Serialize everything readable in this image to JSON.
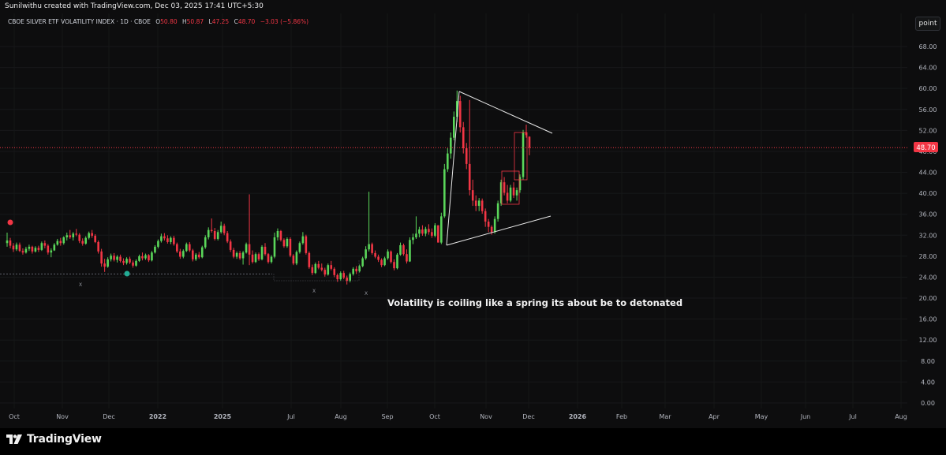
{
  "header": {
    "attribution": "Sunilwithu created with TradingView.com, Dec 03, 2025 17:41 UTC+5:30"
  },
  "legend": {
    "symbol": "CBOE SILVER ETF VOLATILITY INDEX · 1D · CBOE",
    "o_label": "O",
    "o_value": "50.80",
    "h_label": "H",
    "h_value": "50.87",
    "l_label": "L",
    "l_value": "47.25",
    "c_label": "C",
    "c_value": "48.70",
    "change": "−3.03 (−5.86%)"
  },
  "toolbar": {
    "point_label": "point"
  },
  "annotation": {
    "text": "Volatility is coiling like a spring its about be to detonated"
  },
  "price_badge": {
    "value": "48.70",
    "color": "#f23645"
  },
  "markers": {
    "x_label": "X"
  },
  "brand": {
    "name": "TradingView"
  },
  "colors": {
    "up": "#22ab94",
    "down": "#f23645",
    "up_bright": "#5ad65a",
    "background": "#0d0d0e"
  },
  "chart_data": {
    "type": "candlestick",
    "title": "CBOE SILVER ETF VOLATILITY INDEX",
    "interval": "1D",
    "ylim": [
      0,
      72
    ],
    "y_ticks": [
      "68.00",
      "64.00",
      "60.00",
      "56.00",
      "52.00",
      "48.00",
      "44.00",
      "40.00",
      "36.00",
      "32.00",
      "28.00",
      "24.00",
      "20.00",
      "16.00",
      "12.00",
      "8.00",
      "4.00",
      "0.00"
    ],
    "x_ticks": [
      "Oct",
      "Nov",
      "Dec",
      "2022",
      "2025",
      "Jul",
      "Aug",
      "Sep",
      "Oct",
      "Nov",
      "Dec",
      "2026",
      "Feb",
      "Mar",
      "Apr",
      "May",
      "Jun",
      "Jul",
      "Aug"
    ],
    "last_price": 48.7,
    "candles": [
      {
        "o": 30.5,
        "h": 32.5,
        "l": 29.8,
        "c": 31.0
      },
      {
        "o": 31.0,
        "h": 31.5,
        "l": 29.5,
        "c": 30.0
      },
      {
        "o": 30.0,
        "h": 30.5,
        "l": 28.8,
        "c": 29.3
      },
      {
        "o": 29.3,
        "h": 30.6,
        "l": 29.0,
        "c": 30.2
      },
      {
        "o": 30.2,
        "h": 30.6,
        "l": 28.8,
        "c": 29.0
      },
      {
        "o": 29.0,
        "h": 29.5,
        "l": 28.3,
        "c": 28.7
      },
      {
        "o": 28.7,
        "h": 29.8,
        "l": 28.5,
        "c": 29.4
      },
      {
        "o": 29.4,
        "h": 30.2,
        "l": 29.0,
        "c": 29.8
      },
      {
        "o": 29.8,
        "h": 30.0,
        "l": 28.5,
        "c": 28.9
      },
      {
        "o": 28.9,
        "h": 29.9,
        "l": 28.7,
        "c": 29.6
      },
      {
        "o": 29.6,
        "h": 30.0,
        "l": 28.8,
        "c": 29.2
      },
      {
        "o": 29.2,
        "h": 30.8,
        "l": 29.0,
        "c": 30.5
      },
      {
        "o": 30.5,
        "h": 31.0,
        "l": 29.5,
        "c": 30.0
      },
      {
        "o": 30.0,
        "h": 30.3,
        "l": 28.3,
        "c": 28.7
      },
      {
        "o": 28.7,
        "h": 29.5,
        "l": 27.8,
        "c": 29.1
      },
      {
        "o": 29.1,
        "h": 30.5,
        "l": 29.0,
        "c": 30.2
      },
      {
        "o": 30.2,
        "h": 31.3,
        "l": 30.0,
        "c": 30.9
      },
      {
        "o": 30.9,
        "h": 31.5,
        "l": 30.0,
        "c": 30.5
      },
      {
        "o": 30.5,
        "h": 31.8,
        "l": 30.2,
        "c": 31.6
      },
      {
        "o": 31.6,
        "h": 32.5,
        "l": 31.0,
        "c": 32.0
      },
      {
        "o": 32.0,
        "h": 33.0,
        "l": 31.3,
        "c": 31.6
      },
      {
        "o": 31.6,
        "h": 32.6,
        "l": 31.0,
        "c": 32.3
      },
      {
        "o": 32.3,
        "h": 33.2,
        "l": 31.8,
        "c": 32.1
      },
      {
        "o": 32.1,
        "h": 32.4,
        "l": 30.5,
        "c": 30.9
      },
      {
        "o": 30.9,
        "h": 31.4,
        "l": 30.0,
        "c": 30.4
      },
      {
        "o": 30.4,
        "h": 31.8,
        "l": 30.2,
        "c": 31.5
      },
      {
        "o": 31.5,
        "h": 32.7,
        "l": 31.2,
        "c": 32.4
      },
      {
        "o": 32.4,
        "h": 33.0,
        "l": 31.5,
        "c": 31.9
      },
      {
        "o": 31.9,
        "h": 32.2,
        "l": 30.5,
        "c": 30.7
      },
      {
        "o": 30.7,
        "h": 31.0,
        "l": 28.5,
        "c": 28.9
      },
      {
        "o": 28.9,
        "h": 29.4,
        "l": 26.0,
        "c": 26.6
      },
      {
        "o": 26.6,
        "h": 27.5,
        "l": 25.0,
        "c": 26.0
      },
      {
        "o": 26.0,
        "h": 27.8,
        "l": 25.8,
        "c": 27.4
      },
      {
        "o": 27.4,
        "h": 28.5,
        "l": 27.0,
        "c": 28.1
      },
      {
        "o": 28.1,
        "h": 28.6,
        "l": 27.0,
        "c": 27.3
      },
      {
        "o": 27.3,
        "h": 28.2,
        "l": 26.8,
        "c": 27.9
      },
      {
        "o": 27.9,
        "h": 28.3,
        "l": 26.8,
        "c": 27.1
      },
      {
        "o": 27.1,
        "h": 27.6,
        "l": 26.3,
        "c": 26.7
      },
      {
        "o": 26.7,
        "h": 27.8,
        "l": 26.4,
        "c": 27.5
      },
      {
        "o": 27.5,
        "h": 27.9,
        "l": 26.5,
        "c": 26.8
      },
      {
        "o": 26.8,
        "h": 27.2,
        "l": 25.8,
        "c": 26.2
      },
      {
        "o": 26.2,
        "h": 27.4,
        "l": 26.0,
        "c": 27.1
      },
      {
        "o": 27.1,
        "h": 28.3,
        "l": 26.9,
        "c": 28.0
      },
      {
        "o": 28.0,
        "h": 28.7,
        "l": 27.2,
        "c": 27.6
      },
      {
        "o": 27.6,
        "h": 28.5,
        "l": 27.3,
        "c": 28.2
      },
      {
        "o": 28.2,
        "h": 28.4,
        "l": 26.9,
        "c": 27.2
      },
      {
        "o": 27.2,
        "h": 29.0,
        "l": 27.0,
        "c": 28.7
      },
      {
        "o": 28.7,
        "h": 30.1,
        "l": 28.5,
        "c": 29.8
      },
      {
        "o": 29.8,
        "h": 31.2,
        "l": 29.5,
        "c": 30.9
      },
      {
        "o": 30.9,
        "h": 32.3,
        "l": 30.6,
        "c": 31.8
      },
      {
        "o": 31.8,
        "h": 32.4,
        "l": 31.0,
        "c": 31.4
      },
      {
        "o": 31.4,
        "h": 32.0,
        "l": 30.4,
        "c": 30.7
      },
      {
        "o": 30.7,
        "h": 31.8,
        "l": 30.3,
        "c": 31.5
      },
      {
        "o": 31.5,
        "h": 31.9,
        "l": 30.0,
        "c": 30.3
      },
      {
        "o": 30.3,
        "h": 30.6,
        "l": 28.6,
        "c": 28.9
      },
      {
        "o": 28.9,
        "h": 29.4,
        "l": 27.5,
        "c": 27.9
      },
      {
        "o": 27.9,
        "h": 29.3,
        "l": 27.6,
        "c": 29.0
      },
      {
        "o": 29.0,
        "h": 30.6,
        "l": 28.8,
        "c": 30.3
      },
      {
        "o": 30.3,
        "h": 30.7,
        "l": 28.8,
        "c": 29.1
      },
      {
        "o": 29.1,
        "h": 29.4,
        "l": 27.0,
        "c": 27.4
      },
      {
        "o": 27.4,
        "h": 28.6,
        "l": 27.1,
        "c": 28.3
      },
      {
        "o": 28.3,
        "h": 28.8,
        "l": 27.5,
        "c": 27.8
      },
      {
        "o": 27.8,
        "h": 30.0,
        "l": 27.6,
        "c": 29.7
      },
      {
        "o": 29.7,
        "h": 32.0,
        "l": 29.4,
        "c": 31.6
      },
      {
        "o": 31.6,
        "h": 33.5,
        "l": 31.2,
        "c": 33.0
      },
      {
        "o": 33.0,
        "h": 35.2,
        "l": 32.5,
        "c": 32.8
      },
      {
        "o": 32.8,
        "h": 33.4,
        "l": 31.0,
        "c": 31.3
      },
      {
        "o": 31.3,
        "h": 33.0,
        "l": 31.0,
        "c": 32.6
      },
      {
        "o": 32.6,
        "h": 34.6,
        "l": 32.3,
        "c": 33.8
      },
      {
        "o": 33.8,
        "h": 34.2,
        "l": 32.0,
        "c": 32.4
      },
      {
        "o": 32.4,
        "h": 32.8,
        "l": 30.5,
        "c": 30.8
      },
      {
        "o": 30.8,
        "h": 31.2,
        "l": 28.8,
        "c": 29.2
      },
      {
        "o": 29.2,
        "h": 29.6,
        "l": 27.6,
        "c": 27.9
      },
      {
        "o": 27.9,
        "h": 28.9,
        "l": 27.5,
        "c": 28.6
      },
      {
        "o": 28.6,
        "h": 29.0,
        "l": 27.3,
        "c": 27.6
      },
      {
        "o": 27.6,
        "h": 29.0,
        "l": 26.4,
        "c": 28.7
      },
      {
        "o": 28.7,
        "h": 30.6,
        "l": 28.5,
        "c": 30.3
      },
      {
        "o": 30.3,
        "h": 39.8,
        "l": 26.3,
        "c": 28.3
      },
      {
        "o": 28.3,
        "h": 29.1,
        "l": 26.6,
        "c": 26.9
      },
      {
        "o": 26.9,
        "h": 28.7,
        "l": 26.7,
        "c": 28.4
      },
      {
        "o": 28.4,
        "h": 28.7,
        "l": 27.1,
        "c": 27.4
      },
      {
        "o": 27.4,
        "h": 30.1,
        "l": 27.2,
        "c": 29.8
      },
      {
        "o": 29.8,
        "h": 30.5,
        "l": 28.1,
        "c": 28.4
      },
      {
        "o": 28.4,
        "h": 28.6,
        "l": 26.6,
        "c": 26.9
      },
      {
        "o": 26.9,
        "h": 28.2,
        "l": 26.6,
        "c": 27.9
      },
      {
        "o": 27.9,
        "h": 32.5,
        "l": 27.6,
        "c": 31.6
      },
      {
        "o": 31.6,
        "h": 33.3,
        "l": 31.0,
        "c": 32.8
      },
      {
        "o": 32.8,
        "h": 33.0,
        "l": 30.8,
        "c": 31.1
      },
      {
        "o": 31.1,
        "h": 31.4,
        "l": 29.6,
        "c": 29.9
      },
      {
        "o": 29.9,
        "h": 31.6,
        "l": 29.6,
        "c": 31.3
      },
      {
        "o": 31.3,
        "h": 31.6,
        "l": 27.8,
        "c": 28.1
      },
      {
        "o": 28.1,
        "h": 28.4,
        "l": 26.3,
        "c": 26.6
      },
      {
        "o": 26.6,
        "h": 29.1,
        "l": 26.3,
        "c": 28.8
      },
      {
        "o": 28.8,
        "h": 30.8,
        "l": 28.5,
        "c": 30.5
      },
      {
        "o": 30.5,
        "h": 32.6,
        "l": 30.2,
        "c": 31.8
      },
      {
        "o": 31.8,
        "h": 32.1,
        "l": 28.3,
        "c": 28.6
      },
      {
        "o": 28.6,
        "h": 28.9,
        "l": 25.6,
        "c": 25.9
      },
      {
        "o": 25.9,
        "h": 26.4,
        "l": 24.4,
        "c": 24.8
      },
      {
        "o": 24.8,
        "h": 26.8,
        "l": 24.6,
        "c": 26.5
      },
      {
        "o": 26.5,
        "h": 27.1,
        "l": 25.5,
        "c": 25.8
      },
      {
        "o": 25.8,
        "h": 26.6,
        "l": 25.1,
        "c": 25.4
      },
      {
        "o": 25.4,
        "h": 25.8,
        "l": 24.1,
        "c": 24.5
      },
      {
        "o": 24.5,
        "h": 26.6,
        "l": 24.3,
        "c": 26.3
      },
      {
        "o": 26.3,
        "h": 27.1,
        "l": 25.3,
        "c": 25.6
      },
      {
        "o": 25.6,
        "h": 25.9,
        "l": 24.0,
        "c": 24.4
      },
      {
        "o": 24.4,
        "h": 24.7,
        "l": 23.1,
        "c": 23.6
      },
      {
        "o": 23.6,
        "h": 25.1,
        "l": 23.3,
        "c": 24.8
      },
      {
        "o": 24.8,
        "h": 25.2,
        "l": 23.6,
        "c": 23.9
      },
      {
        "o": 23.9,
        "h": 24.3,
        "l": 22.6,
        "c": 23.3
      },
      {
        "o": 23.3,
        "h": 24.9,
        "l": 23.0,
        "c": 24.6
      },
      {
        "o": 24.6,
        "h": 25.9,
        "l": 24.3,
        "c": 25.6
      },
      {
        "o": 25.6,
        "h": 26.1,
        "l": 24.6,
        "c": 25.1
      },
      {
        "o": 25.1,
        "h": 26.4,
        "l": 24.9,
        "c": 26.1
      },
      {
        "o": 26.1,
        "h": 27.9,
        "l": 25.9,
        "c": 27.6
      },
      {
        "o": 27.6,
        "h": 29.9,
        "l": 27.3,
        "c": 29.3
      },
      {
        "o": 29.3,
        "h": 40.3,
        "l": 28.9,
        "c": 30.3
      },
      {
        "o": 30.3,
        "h": 30.6,
        "l": 28.3,
        "c": 28.6
      },
      {
        "o": 28.6,
        "h": 29.1,
        "l": 27.6,
        "c": 27.9
      },
      {
        "o": 27.9,
        "h": 28.3,
        "l": 26.9,
        "c": 27.3
      },
      {
        "o": 27.3,
        "h": 27.6,
        "l": 25.9,
        "c": 26.3
      },
      {
        "o": 26.3,
        "h": 27.9,
        "l": 26.1,
        "c": 27.6
      },
      {
        "o": 27.6,
        "h": 29.3,
        "l": 27.3,
        "c": 28.9
      },
      {
        "o": 28.9,
        "h": 29.1,
        "l": 26.6,
        "c": 26.9
      },
      {
        "o": 26.9,
        "h": 27.4,
        "l": 25.3,
        "c": 25.7
      },
      {
        "o": 25.7,
        "h": 28.6,
        "l": 25.5,
        "c": 28.3
      },
      {
        "o": 28.3,
        "h": 30.6,
        "l": 28.1,
        "c": 30.1
      },
      {
        "o": 30.1,
        "h": 30.4,
        "l": 28.1,
        "c": 28.4
      },
      {
        "o": 28.4,
        "h": 29.3,
        "l": 26.6,
        "c": 27.0
      },
      {
        "o": 27.0,
        "h": 31.6,
        "l": 26.9,
        "c": 31.1
      },
      {
        "o": 31.1,
        "h": 32.3,
        "l": 30.3,
        "c": 31.6
      },
      {
        "o": 31.6,
        "h": 35.6,
        "l": 31.3,
        "c": 32.3
      },
      {
        "o": 32.3,
        "h": 33.6,
        "l": 31.6,
        "c": 33.1
      },
      {
        "o": 33.1,
        "h": 33.9,
        "l": 31.9,
        "c": 32.3
      },
      {
        "o": 32.3,
        "h": 33.6,
        "l": 31.8,
        "c": 33.2
      },
      {
        "o": 33.2,
        "h": 34.1,
        "l": 32.1,
        "c": 32.6
      },
      {
        "o": 32.6,
        "h": 33.3,
        "l": 31.5,
        "c": 31.9
      },
      {
        "o": 31.9,
        "h": 34.3,
        "l": 31.6,
        "c": 33.9
      },
      {
        "o": 33.9,
        "h": 33.9,
        "l": 30.6,
        "c": 30.6
      },
      {
        "o": 30.6,
        "h": 36.3,
        "l": 30.3,
        "c": 35.6
      },
      {
        "o": 35.6,
        "h": 45.6,
        "l": 35.3,
        "c": 44.6
      },
      {
        "o": 44.6,
        "h": 48.6,
        "l": 44.1,
        "c": 47.6
      },
      {
        "o": 47.6,
        "h": 51.6,
        "l": 46.6,
        "c": 50.6
      },
      {
        "o": 50.6,
        "h": 55.6,
        "l": 50.1,
        "c": 54.6
      },
      {
        "o": 54.6,
        "h": 59.6,
        "l": 53.6,
        "c": 57.6
      },
      {
        "o": 57.6,
        "h": 58.6,
        "l": 51.6,
        "c": 52.6
      },
      {
        "o": 52.6,
        "h": 53.6,
        "l": 47.6,
        "c": 48.6
      },
      {
        "o": 48.6,
        "h": 49.6,
        "l": 44.6,
        "c": 45.6
      },
      {
        "o": 45.6,
        "h": 57.8,
        "l": 39.6,
        "c": 40.6
      },
      {
        "o": 40.6,
        "h": 42.6,
        "l": 37.6,
        "c": 38.6
      },
      {
        "o": 38.6,
        "h": 39.6,
        "l": 36.6,
        "c": 37.6
      },
      {
        "o": 37.6,
        "h": 39.1,
        "l": 36.6,
        "c": 38.6
      },
      {
        "o": 38.6,
        "h": 39.0,
        "l": 36.1,
        "c": 36.6
      },
      {
        "o": 36.6,
        "h": 37.1,
        "l": 33.6,
        "c": 34.6
      },
      {
        "o": 34.6,
        "h": 35.1,
        "l": 32.6,
        "c": 33.6
      },
      {
        "o": 33.6,
        "h": 33.9,
        "l": 32.1,
        "c": 32.6
      },
      {
        "o": 32.6,
        "h": 35.6,
        "l": 32.3,
        "c": 35.1
      },
      {
        "o": 35.1,
        "h": 38.6,
        "l": 34.6,
        "c": 38.1
      },
      {
        "o": 38.1,
        "h": 42.6,
        "l": 37.6,
        "c": 42.1
      },
      {
        "o": 42.1,
        "h": 43.1,
        "l": 39.6,
        "c": 40.1
      },
      {
        "o": 40.1,
        "h": 41.6,
        "l": 38.1,
        "c": 38.6
      },
      {
        "o": 38.6,
        "h": 41.6,
        "l": 38.3,
        "c": 41.1
      },
      {
        "o": 41.1,
        "h": 42.1,
        "l": 39.1,
        "c": 39.6
      },
      {
        "o": 39.6,
        "h": 41.1,
        "l": 38.6,
        "c": 40.6
      },
      {
        "o": 40.6,
        "h": 43.6,
        "l": 40.1,
        "c": 43.1
      },
      {
        "o": 43.1,
        "h": 52.1,
        "l": 42.6,
        "c": 51.6
      },
      {
        "o": 51.6,
        "h": 53.1,
        "l": 50.6,
        "c": 51.1
      },
      {
        "o": 50.8,
        "h": 50.87,
        "l": 47.25,
        "c": 48.7
      }
    ]
  }
}
